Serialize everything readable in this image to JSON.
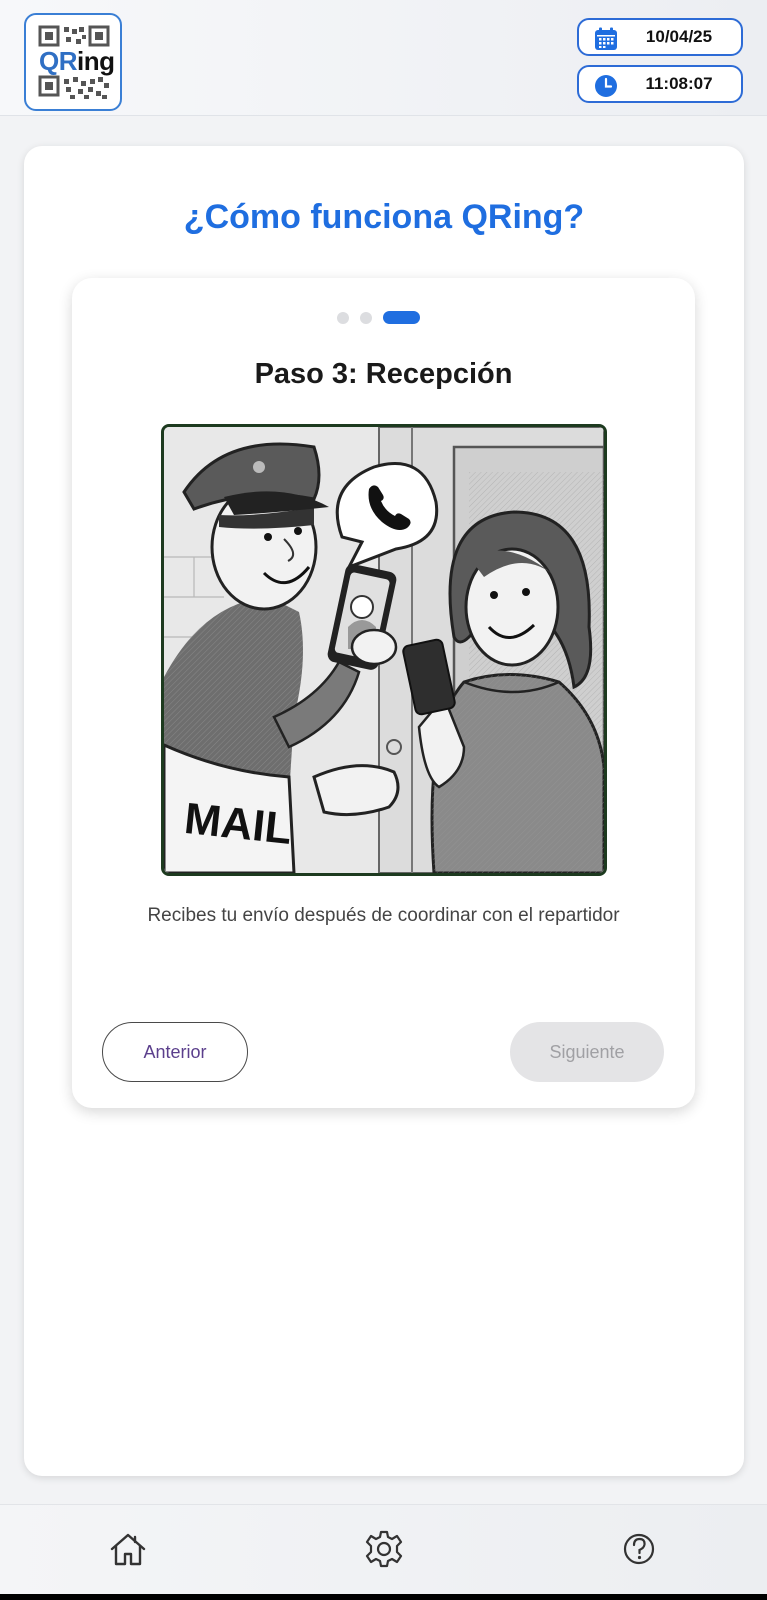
{
  "header": {
    "logo": {
      "text_q": "QR",
      "text_ing": "ing",
      "icon": "qr-logo-icon"
    },
    "date": {
      "value": "10/04/25",
      "icon": "calendar-icon"
    },
    "time": {
      "value": "11:08:07",
      "icon": "clock-icon"
    }
  },
  "main": {
    "title": "¿Cómo funciona QRing?",
    "carousel": {
      "total_steps": 3,
      "active_step": 3,
      "step_title": "Paso 3: Recepción",
      "illustration_text": "MAIL",
      "description": "Recibes tu envío después de coordinar con el repartidor",
      "prev_label": "Anterior",
      "next_label": "Siguiente",
      "next_disabled": true
    }
  },
  "bottom_nav": {
    "items": [
      {
        "icon": "home-icon"
      },
      {
        "icon": "gear-icon"
      },
      {
        "icon": "help-icon"
      }
    ]
  },
  "colors": {
    "accent": "#1f6ee0",
    "pill_border": "#2d6bd6",
    "prev_text": "#5b3f8c",
    "disabled_bg": "#e4e4e6"
  }
}
